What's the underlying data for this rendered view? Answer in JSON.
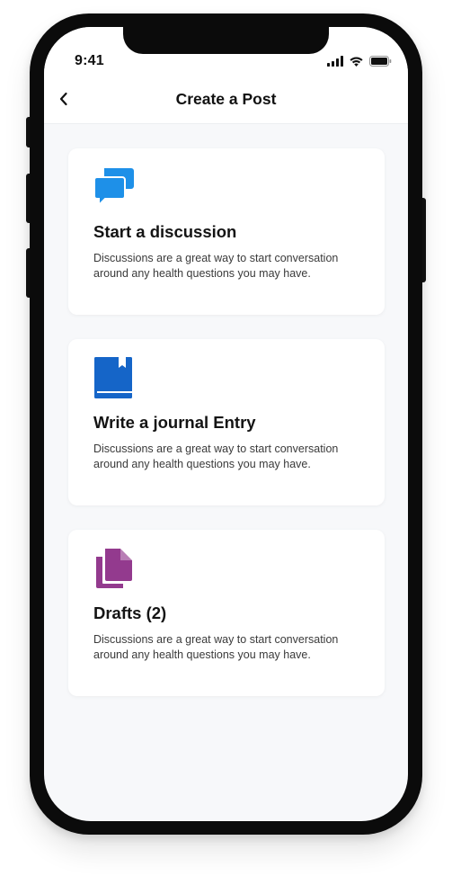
{
  "status_bar": {
    "time": "9:41",
    "icons": [
      "cellular-signal-icon",
      "wifi-icon",
      "battery-icon"
    ]
  },
  "header": {
    "back_icon": "chevron-left-icon",
    "title": "Create a Post"
  },
  "options": [
    {
      "icon": "chat-bubbles-icon",
      "icon_color": "#1e90e8",
      "title": "Start a discussion",
      "description": "Discussions are a great way to start conversation around any health questions you may have."
    },
    {
      "icon": "journal-book-icon",
      "icon_color": "#1565c8",
      "title": "Write a journal Entry",
      "description": "Discussions are a great way to start conversation around any health questions you may have."
    },
    {
      "icon": "drafts-documents-icon",
      "icon_color": "#933a8e",
      "title": "Drafts (2)",
      "description": "Discussions are a great way to start conversation around any health questions you may have."
    }
  ],
  "colors": {
    "screen_background": "#f7f8fa",
    "card_background": "#ffffff",
    "text_primary": "#141414",
    "text_secondary": "#3a3a3a",
    "device_frame": "#0b0b0b"
  }
}
